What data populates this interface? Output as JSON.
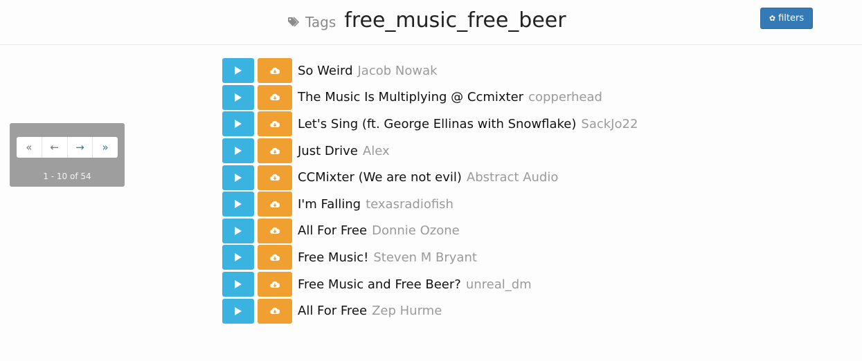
{
  "header": {
    "tags_label": "Tags",
    "tag_name": "free_music_free_beer",
    "filters_label": "filters"
  },
  "pager": {
    "first": "«",
    "prev": "←",
    "next": "→",
    "last": "»",
    "count_text": "1 - 10 of 54"
  },
  "tracks": [
    {
      "title": "So Weird",
      "artist": "Jacob Nowak"
    },
    {
      "title": "The Music Is Multiplying @ Ccmixter",
      "artist": "copperhead"
    },
    {
      "title": "Let's Sing (ft. George Ellinas with Snowflake)",
      "artist": "SackJo22"
    },
    {
      "title": "Just Drive",
      "artist": "Alex"
    },
    {
      "title": "CCMixter (We are not evil)",
      "artist": "Abstract Audio"
    },
    {
      "title": "I'm Falling",
      "artist": "texasradiofish"
    },
    {
      "title": "All For Free",
      "artist": "Donnie Ozone"
    },
    {
      "title": "Free Music!",
      "artist": "Steven M Bryant"
    },
    {
      "title": "Free Music and Free Beer?",
      "artist": "unreal_dm"
    },
    {
      "title": "All For Free",
      "artist": "Zep Hurme"
    }
  ],
  "icons": {
    "play": "play-icon",
    "download": "cloud-download-icon",
    "tag": "tag-icon",
    "gear": "gear-icon"
  },
  "colors": {
    "play_button": "#3bb3e0",
    "download_button": "#f0a030",
    "filters_button": "#337ab7",
    "pager_panel": "#9e9e9e"
  }
}
